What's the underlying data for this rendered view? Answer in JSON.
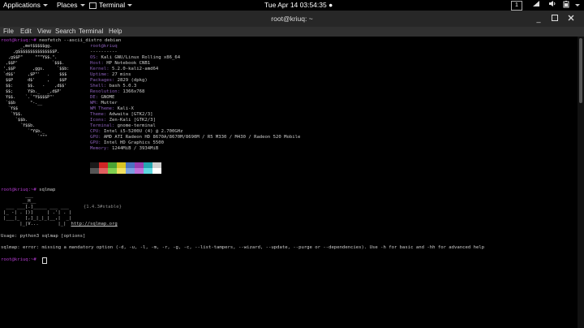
{
  "topbar": {
    "applications": "Applications",
    "places": "Places",
    "app_name": "Terminal",
    "clock": "Tue Apr 14  03:54:35 ●",
    "workspace": "1"
  },
  "window": {
    "title": "root@kriuq: ~"
  },
  "menu": [
    "File",
    "Edit",
    "View",
    "Search",
    "Terminal",
    "Help"
  ],
  "terminal": {
    "cmd1": {
      "prompt": "root@kriuq:~#",
      "command": " neofetch --ascii_distro debian"
    },
    "logo": [
      "       _,met$$$$$gg.",
      "    ,g$$$$$$$$$$$$$$$P.",
      "  ,g$$P\"     \"\"\"Y$$.\".",
      " ,$$P'              `$$$.",
      "',$$P       ,ggs.     `$$b:",
      "`d$$'     ,$P\"'   .    $$$",
      " $$P      d$'     ,    $$P",
      " $$:      $$.   -    ,d$$'",
      " $$;      Y$b._   _,d$P'",
      " Y$$.    `.`\"Y$$$$P\"'",
      " `$$b      \"-.__",
      "  `Y$$",
      "   `Y$$.",
      "     `$$b.",
      "       `Y$$b.",
      "          `\"Y$b._",
      "              `\"\"\""
    ],
    "userhost": "root@kriuq",
    "separator": "----------",
    "info": [
      {
        "key": "OS:",
        "value": " Kali GNU/Linux Rolling x86_64"
      },
      {
        "key": "Host:",
        "value": " HP Notebook CNB1"
      },
      {
        "key": "Kernel:",
        "value": " 5.2.0-kali2-amd64"
      },
      {
        "key": "Uptime:",
        "value": " 27 mins"
      },
      {
        "key": "Packages:",
        "value": " 2829 (dpkg)"
      },
      {
        "key": "Shell:",
        "value": " bash 5.0.3"
      },
      {
        "key": "Resolution:",
        "value": " 1366x768"
      },
      {
        "key": "DE:",
        "value": " GNOME"
      },
      {
        "key": "WM:",
        "value": " Mutter"
      },
      {
        "key": "WM Theme:",
        "value": " Kali-X"
      },
      {
        "key": "Theme:",
        "value": " Adwaita [GTK2/3]"
      },
      {
        "key": "Icons:",
        "value": " Zen-Kali [GTK2/3]"
      },
      {
        "key": "Terminal:",
        "value": " gnome-terminal"
      },
      {
        "key": "CPU:",
        "value": " Intel i5-5200U (4) @ 2.700GHz"
      },
      {
        "key": "GPU:",
        "value": " AMD ATI Radeon HD 8670A/8670M/8690M / R5 M330 / M430 / Radeon 520 Mobile"
      },
      {
        "key": "GPU:",
        "value": " Intel HD Graphics 5500"
      },
      {
        "key": "Memory:",
        "value": " 1244MiB / 3934MiB"
      }
    ],
    "palette_top": [
      "#1a1a1a",
      "#d02525",
      "#4aa334",
      "#d8c424",
      "#4b72c0",
      "#9b3fb0",
      "#24a6b0",
      "#d0d0d0"
    ],
    "palette_bottom": [
      "#555555",
      "#e06060",
      "#80d050",
      "#f0e060",
      "#7aa0e0",
      "#c070d8",
      "#60d8e0",
      "#ffffff"
    ],
    "cmd2": {
      "prompt": "root@kriuq:~#",
      "command": " sqlmap"
    },
    "sqlmap_logo": [
      "        ___",
      "       __H__",
      " ___ ___[.]_____ ___ ___",
      "|_ -| . [)]     | .'| . |",
      "|___|_  [,]_|_|_|__,|  _|",
      "      |_|V...       |_|"
    ],
    "sqlmap_version": "{1.4.3#stable}",
    "sqlmap_url": "http://sqlmap.org",
    "usage": "Usage: python3 sqlmap [options]",
    "error": "sqlmap: error: missing a mandatory option (-d, -u, -l, -m, -r, -g, -c, --list-tampers, --wizard, --update, --purge or --dependencies). Use -h for basic and -hh for advanced help",
    "cmd3": {
      "prompt": "root@kriuq:~#"
    }
  }
}
